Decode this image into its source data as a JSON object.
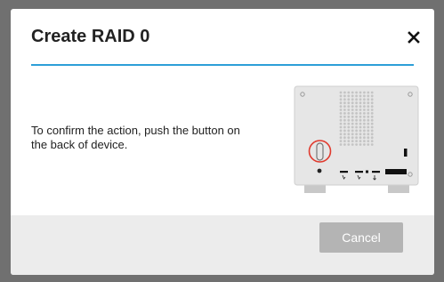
{
  "dialog": {
    "title": "Create RAID 0",
    "close_icon": "close-icon",
    "message_line1": "To confirm the action, push the button on",
    "message_line2": "the back of device.",
    "cancel_label": "Cancel"
  },
  "illustration": {
    "name": "device-back-illustration",
    "highlight_icon": "red-circle-highlight"
  },
  "colors": {
    "accent": "#2d9fd8",
    "overlay": "#707070",
    "footer_bg": "#ececec",
    "button_bg": "#b4b4b4",
    "highlight": "#e03a2e"
  }
}
